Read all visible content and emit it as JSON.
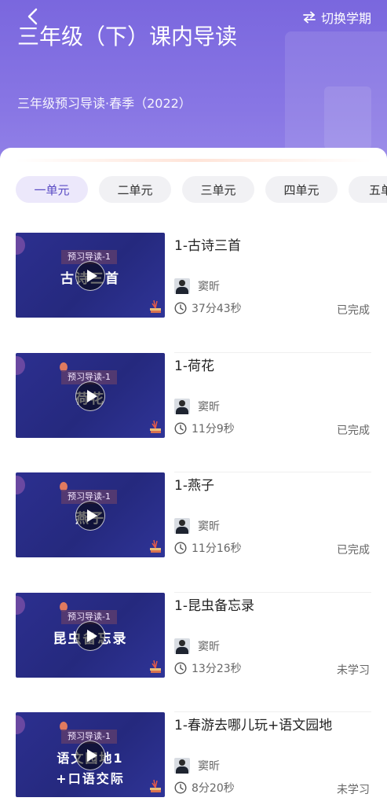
{
  "header": {
    "title": "三年级（下）课内导读",
    "subtitle": "三年级预习导读·春季（2022）",
    "switch_label": "切换学期",
    "background_color": "#7a67de"
  },
  "tabs": [
    {
      "label": "一单元",
      "active": true
    },
    {
      "label": "二单元",
      "active": false
    },
    {
      "label": "三单元",
      "active": false
    },
    {
      "label": "四单元",
      "active": false
    },
    {
      "label": "五单",
      "active": false
    }
  ],
  "lessons": [
    {
      "title": "1-古诗三首",
      "thumb_badge": "预习导读-1",
      "thumb_text": "古诗三首",
      "teacher": "窦昕",
      "duration": "37分43秒",
      "status": "已完成"
    },
    {
      "title": "1-荷花",
      "thumb_badge": "预习导读-1",
      "thumb_text": "荷花",
      "teacher": "窦昕",
      "duration": "11分9秒",
      "status": "已完成"
    },
    {
      "title": "1-燕子",
      "thumb_badge": "预习导读-1",
      "thumb_text": "燕子",
      "teacher": "窦昕",
      "duration": "11分16秒",
      "status": "已完成"
    },
    {
      "title": "1-昆虫备忘录",
      "thumb_badge": "预习导读-1",
      "thumb_text": "昆虫备忘录",
      "teacher": "窦昕",
      "duration": "13分23秒",
      "status": "未学习"
    },
    {
      "title": "1-春游去哪儿玩+语文园地",
      "thumb_badge": "预习导读-1",
      "thumb_text": "语文园地1",
      "thumb_text2": "+口语交际",
      "teacher": "窦昕",
      "duration": "8分20秒",
      "status": "未学习"
    }
  ]
}
